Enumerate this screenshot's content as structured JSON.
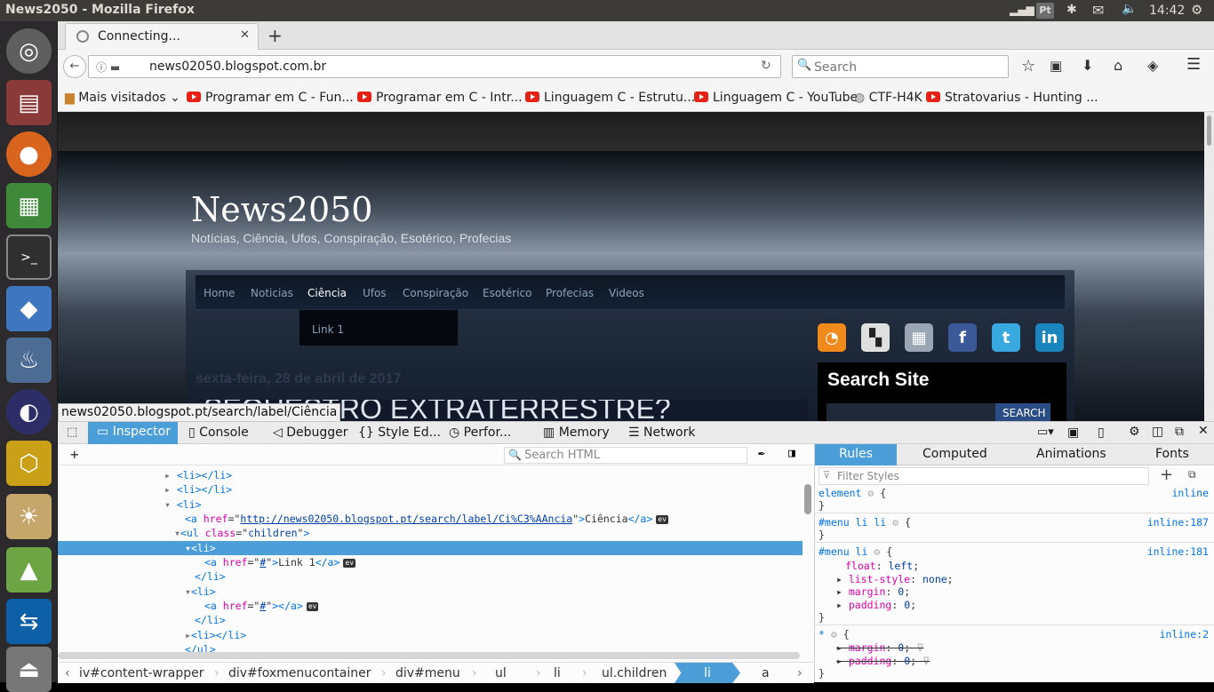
{
  "system": {
    "window_title": "News2050 - Mozilla Firefox",
    "clock": "14:42",
    "indicators": [
      "signal-icon",
      "pt-keyboard-icon",
      "bluetooth-icon",
      "mail-icon",
      "volume-icon",
      "settings-icon"
    ],
    "keyboard_label": "Pt"
  },
  "launcher": {
    "items": [
      "ubuntu-dash-icon",
      "files-icon",
      "firefox-icon",
      "spreadsheet-icon",
      "terminal-icon",
      "virtualbox-icon",
      "postgresql-icon",
      "eclipse-icon",
      "vpn-icon",
      "settings-icon",
      "android-studio-icon",
      "teamviewer-icon",
      "usb-icon"
    ]
  },
  "browser": {
    "tab_title": "Connecting...",
    "url": "news02050.blogspot.com.br",
    "search_placeholder": "Search",
    "bookmarks": [
      {
        "label": "Mais visitados",
        "icon": "folder-icon"
      },
      {
        "label": "Programar em C - Fun...",
        "icon": "youtube-icon"
      },
      {
        "label": "Programar em C - Intr...",
        "icon": "youtube-icon"
      },
      {
        "label": "Linguagem C - Estrutu...",
        "icon": "youtube-icon"
      },
      {
        "label": "Linguagem C - YouTube",
        "icon": "youtube-icon"
      },
      {
        "label": "CTF-H4K",
        "icon": "globe-icon"
      },
      {
        "label": "Stratovarius - Hunting ...",
        "icon": "youtube-icon"
      }
    ],
    "status_url": "news02050.blogspot.pt/search/label/Ciência"
  },
  "page": {
    "site_title": "News2050",
    "site_description": "Notícias, Ciência, Ufos, Conspiração, Esotérico, Profecias",
    "menu": [
      "Home",
      "Noticias",
      "Ciência",
      "Ufos",
      "Conspiração",
      "Esotérico",
      "Profecias",
      "Videos"
    ],
    "dropdown_item": "Link 1",
    "date": "sexta-feira, 28 de abril de 2017",
    "post_title": "SEQUESTRO EXTRATERRESTRE?",
    "search_heading": "Search Site",
    "search_button": "SEARCH",
    "social": [
      "rss-icon",
      "delicious-icon",
      "digg-icon",
      "facebook-icon",
      "twitter-icon",
      "linkedin-icon"
    ]
  },
  "devtools": {
    "tabs": [
      "Inspector",
      "Console",
      "Debugger",
      "Style Ed...",
      "Perfor...",
      "Memory",
      "Network"
    ],
    "search_html_placeholder": "Search HTML",
    "side_tabs": [
      "Rules",
      "Computed",
      "Animations",
      "Fonts"
    ],
    "filter_placeholder": "Filter Styles",
    "markup": {
      "l1": "<li></li>",
      "l2": "<li></li>",
      "l3": "<li>",
      "a_href": "http://news02050.blogspot.pt/search/label/Ci%C3%AAncia",
      "a_text": "Ciência",
      "ul_class": "children",
      "li_sel": "<li>",
      "link1_href": "#",
      "link1_text": "Link 1",
      "li_close": "</li>",
      "li2": "<li>",
      "link2_href": "#",
      "li2_close": "</li>",
      "l_last": "<li></li>",
      "ul_close": "</ul>",
      "ev": "ev"
    },
    "rules": [
      {
        "selector": "element",
        "source": "inline"
      },
      {
        "selector": "#menu li li",
        "source": "inline:187"
      },
      {
        "selector": "#menu li",
        "source": "inline:181",
        "props": [
          {
            "name": "float",
            "value": "left"
          },
          {
            "name": "list-style",
            "value": "none"
          },
          {
            "name": "margin",
            "value": "0"
          },
          {
            "name": "padding",
            "value": "0"
          }
        ]
      },
      {
        "selector": "*",
        "source": "inline:2",
        "props": [
          {
            "name": "margin",
            "value": "0"
          },
          {
            "name": "padding",
            "value": "0"
          }
        ]
      }
    ],
    "breadcrumbs": [
      "iv#content-wrapper",
      "div#foxmenucontainer",
      "div#menu",
      "ul",
      "li",
      "ul.children",
      "li",
      "a"
    ]
  }
}
